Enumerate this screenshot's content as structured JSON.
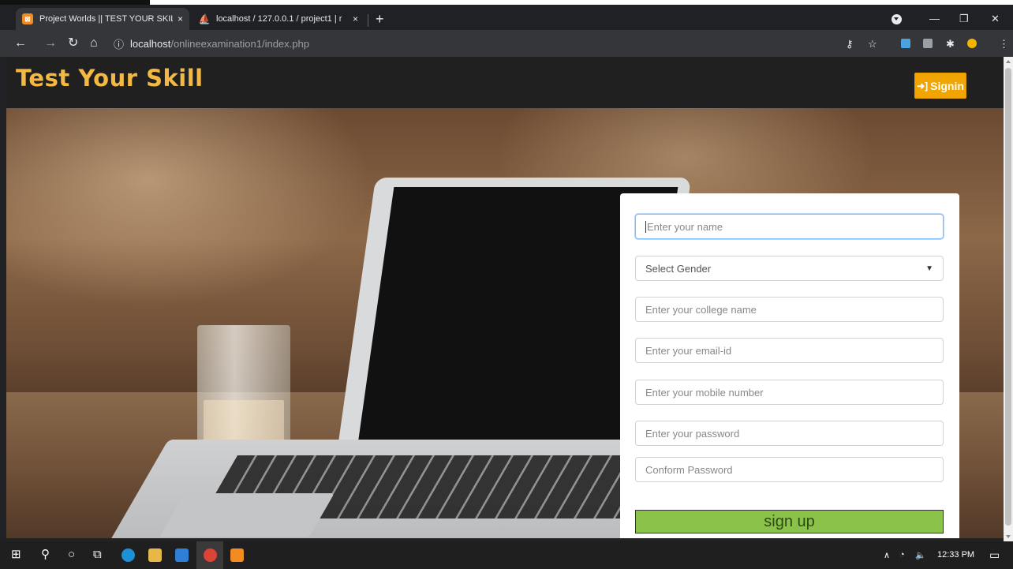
{
  "browser": {
    "tabs": [
      {
        "title": "Project Worlds || TEST YOUR SKIL",
        "active": true
      },
      {
        "title": "localhost / 127.0.0.1 / project1 | r",
        "active": false
      }
    ],
    "close_glyph": "×",
    "new_tab_glyph": "+",
    "url_host": "localhost",
    "url_path": "/onlineexamination1/index.php",
    "icons": [
      "back-icon",
      "forward-icon",
      "reload-icon",
      "home-icon",
      "info-icon",
      "key-icon",
      "star-icon",
      "extensions-icon",
      "menu-icon",
      "profile-icon"
    ]
  },
  "header": {
    "logo": "Test Your Skill",
    "signin_label": "Signin"
  },
  "form": {
    "name_placeholder": "Enter your name",
    "gender_label": "Select Gender",
    "college_placeholder": "Enter your college name",
    "email_placeholder": "Enter your email-id",
    "mobile_placeholder": "Enter your mobile number",
    "password_placeholder": "Enter your password",
    "confirm_placeholder": "Conform Password",
    "submit_label": "sign up"
  },
  "taskbar": {
    "time": "12:33 PM"
  },
  "colors": {
    "logo": "#f4b942",
    "signin_bg": "#f0a500",
    "signup_bg": "#8bc34a"
  }
}
